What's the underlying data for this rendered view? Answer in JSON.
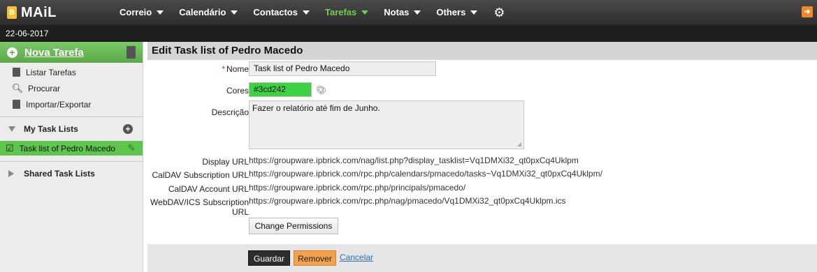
{
  "brand": {
    "icon_letter": "B",
    "name": "MAiL"
  },
  "nav": {
    "items": [
      {
        "label": "Correio",
        "active": false
      },
      {
        "label": "Calendário",
        "active": false
      },
      {
        "label": "Contactos",
        "active": false
      },
      {
        "label": "Tarefas",
        "active": true
      },
      {
        "label": "Notas",
        "active": false
      },
      {
        "label": "Others",
        "active": false
      }
    ],
    "settings_icon": "gear-icon",
    "logout_icon": "logout-icon"
  },
  "date": "22-06-2017",
  "sidebar": {
    "new_task": "Nova Tarefa",
    "links": [
      {
        "label": "Listar Tarefas",
        "icon": "clipboard-icon"
      },
      {
        "label": "Procurar",
        "icon": "search-icon"
      },
      {
        "label": "Importar/Exportar",
        "icon": "import-export-icon"
      }
    ],
    "my_lists_title": "My Task Lists",
    "my_lists": [
      {
        "label": "Task list of Pedro Macedo",
        "selected": true
      }
    ],
    "shared_lists_title": "Shared Task Lists"
  },
  "main": {
    "title": "Edit Task list of Pedro Macedo",
    "labels": {
      "name": "Nome",
      "colors": "Cores",
      "description": "Descrição",
      "display_url": "Display URL",
      "caldav_sub": "CalDAV Subscription URL",
      "caldav_account": "CalDAV Account URL",
      "webdav_line1": "WebDAV/ICS Subscription",
      "webdav_line2": "URL"
    },
    "values": {
      "name": "Task list of Pedro Macedo",
      "color": "#3cd242",
      "description": "Fazer o relatório até fim de Junho.",
      "display_url": "https://groupware.ipbrick.com/nag/list.php?display_tasklist=Vq1DMXi32_qt0pxCq4Uklpm",
      "caldav_sub": "https://groupware.ipbrick.com/rpc.php/calendars/pmacedo/tasks~Vq1DMXi32_qt0pxCq4Uklpm/",
      "caldav_account": "https://groupware.ipbrick.com/rpc.php/principals/pmacedo/",
      "webdav": "https://groupware.ipbrick.com/rpc.php/nag/pmacedo/Vq1DMXi32_qt0pxCq4Uklpm.ics"
    },
    "buttons": {
      "permissions": "Change Permissions",
      "save": "Guardar",
      "remove": "Remover",
      "cancel": "Cancelar"
    }
  }
}
